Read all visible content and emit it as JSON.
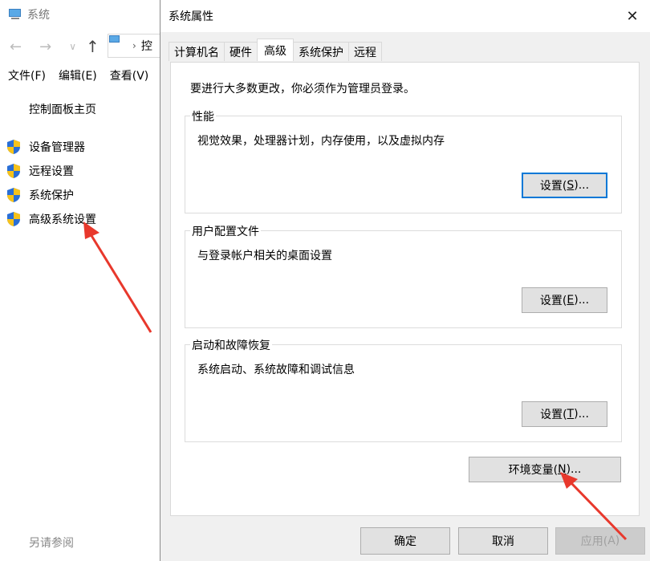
{
  "background_window": {
    "title": "系统",
    "address_text": "控",
    "menu": [
      "文件(F)",
      "编辑(E)",
      "查看(V)"
    ],
    "control_panel_home": "控制面板主页",
    "side_links": [
      "设备管理器",
      "远程设置",
      "系统保护",
      "高级系统设置"
    ],
    "see_also": "另请参阅"
  },
  "dialog": {
    "title": "系统属性",
    "tabs": [
      "计算机名",
      "硬件",
      "高级",
      "系统保护",
      "远程"
    ],
    "active_tab": "高级",
    "intro": "要进行大多数更改，你必须作为管理员登录。",
    "groups": {
      "performance": {
        "legend": "性能",
        "description": "视觉效果，处理器计划，内存使用，以及虚拟内存",
        "button_prefix": "设置(",
        "button_key": "S",
        "button_suffix": ")..."
      },
      "user_profiles": {
        "legend": "用户配置文件",
        "description": "与登录帐户相关的桌面设置",
        "button_prefix": "设置(",
        "button_key": "E",
        "button_suffix": ")..."
      },
      "startup_recovery": {
        "legend": "启动和故障恢复",
        "description": "系统启动、系统故障和调试信息",
        "button_prefix": "设置(",
        "button_key": "T",
        "button_suffix": ")..."
      }
    },
    "env_button": {
      "prefix": "环境变量(",
      "key": "N",
      "suffix": ")..."
    },
    "footer": {
      "ok": "确定",
      "cancel": "取消",
      "apply_prefix": "应用(",
      "apply_key": "A",
      "apply_suffix": ")"
    }
  },
  "colors": {
    "accent": "#0078d7",
    "annotation_arrow": "#e8382c"
  }
}
